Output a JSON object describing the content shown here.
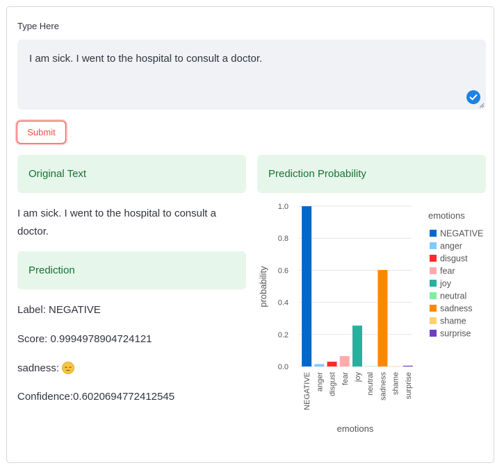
{
  "input": {
    "label": "Type Here",
    "value": "I am sick. I went to the hospital to consult a doctor."
  },
  "submit_label": "Submit",
  "left": {
    "original_header": "Original Text",
    "original_line1": "I am sick. I went to the hospital to consult a",
    "original_line2": "doctor.",
    "prediction_header": "Prediction",
    "label_text": "Label: NEGATIVE",
    "score_text": "Score: 0.9994978904724121",
    "emotion_text": "sadness:",
    "emotion_icon": "pensive-face-emoji",
    "confidence_text": "Confidence:0.6020694772412545"
  },
  "right": {
    "probability_header": "Prediction Probability"
  },
  "chart_data": {
    "type": "bar",
    "xlabel": "emotions",
    "ylabel": "probability",
    "ylim": [
      0,
      1.0
    ],
    "yticks": [
      "0.0",
      "0.2",
      "0.4",
      "0.6",
      "0.8",
      "1.0"
    ],
    "grid": true,
    "legend_title": "emotions",
    "legend_position": "right",
    "categories": [
      "NEGATIVE",
      "anger",
      "disgust",
      "fear",
      "joy",
      "neutral",
      "sadness",
      "shame",
      "surprise"
    ],
    "values": [
      0.9995,
      0.015,
      0.03,
      0.065,
      0.255,
      0.002,
      0.602,
      0.001,
      0.005
    ],
    "colors": [
      "#0068c9",
      "#83c9ff",
      "#ff2b2b",
      "#ffabab",
      "#29b09d",
      "#7defa1",
      "#ff8700",
      "#ffd16a",
      "#6d3fc0"
    ]
  }
}
